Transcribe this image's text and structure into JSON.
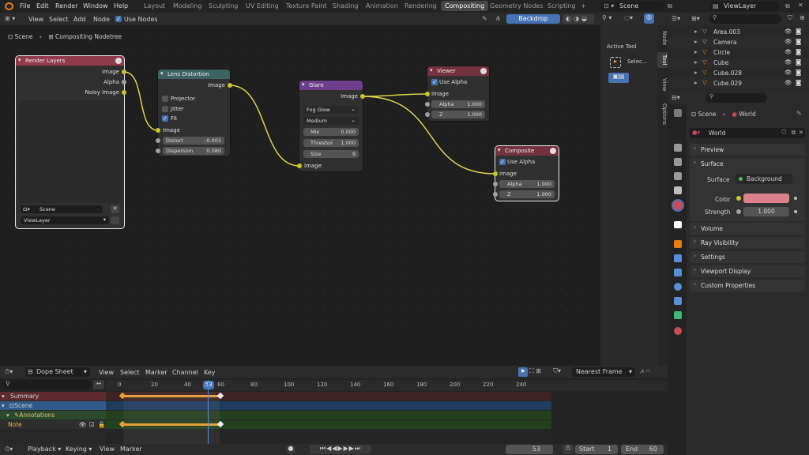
{
  "menu": {
    "file": "File",
    "edit": "Edit",
    "render": "Render",
    "window": "Window",
    "help": "Help"
  },
  "workspaces": [
    "Layout",
    "Modeling",
    "Sculpting",
    "UV Editing",
    "Texture Paint",
    "Shading",
    "Animation",
    "Rendering",
    "Compositing",
    "Geometry Nodes",
    "Scripting",
    "+"
  ],
  "active_workspace": "Compositing",
  "scene_field": "Scene",
  "viewlayer_field": "ViewLayer",
  "node_editor": {
    "header": {
      "view": "View",
      "select": "Select",
      "add": "Add",
      "node": "Node",
      "use_nodes": "Use Nodes",
      "backdrop": "Backdrop"
    },
    "breadcrumb": {
      "scene": "Scene",
      "tree": "Compositing Nodetree"
    },
    "nodes": {
      "render_layers": {
        "title": "Render Layers",
        "out_image": "Image",
        "out_alpha": "Alpha",
        "out_noisy": "Noisy Image",
        "scene": "Scene",
        "viewlayer": "ViewLayer"
      },
      "lens": {
        "title": "Lens Distortion",
        "out_image": "Image",
        "projector": "Projector",
        "jitter": "Jitter",
        "fit": "Fit",
        "in_image": "Image",
        "distort_label": "Distort",
        "distort_val": "-0.001",
        "dispersion_label": "Dispersion",
        "dispersion_val": "0.080"
      },
      "glare": {
        "title": "Glare",
        "out_image": "Image",
        "type": "Fog Glow",
        "quality": "Medium",
        "mix_label": "Mix",
        "mix_val": "0.000",
        "threshold_label": "Threshol",
        "threshold_val": "1.000",
        "size_label": "Size",
        "size_val": "9",
        "in_image": "Image"
      },
      "viewer": {
        "title": "Viewer",
        "use_alpha": "Use Alpha",
        "in_image": "Image",
        "alpha_label": "Alpha",
        "alpha_val": "1.000",
        "z_label": "Z",
        "z_val": "1.000"
      },
      "composite": {
        "title": "Composite",
        "use_alpha": "Use Alpha",
        "in_image": "Image",
        "alpha_label": "Alpha",
        "alpha_val": "1.000",
        "z_label": "Z",
        "z_val": "1.000"
      }
    },
    "sidebar": {
      "active_tool": "Active Tool",
      "select": "Selec...",
      "tabs": [
        "Node",
        "Tool",
        "View",
        "Options"
      ]
    }
  },
  "outliner": {
    "items": [
      "Area.003",
      "Camera",
      "Circle",
      "Cube",
      "Cube.028",
      "Cube.029"
    ]
  },
  "properties": {
    "breadcrumb_scene": "Scene",
    "breadcrumb_world": "World",
    "world_name": "World",
    "panels": {
      "preview": "Preview",
      "surface": "Surface",
      "volume": "Volume",
      "ray_visibility": "Ray Visibility",
      "settings": "Settings",
      "viewport_display": "Viewport Display",
      "custom_properties": "Custom Properties"
    },
    "surface_label": "Surface",
    "surface_value": "Background",
    "color_label": "Color",
    "color_value": "#d9818c",
    "strength_label": "Strength",
    "strength_value": "1.000"
  },
  "dopesheet": {
    "mode": "Dope Sheet",
    "view": "View",
    "select": "Select",
    "marker": "Marker",
    "channel": "Channel",
    "key": "Key",
    "snapping": "Nearest Frame",
    "ticks": [
      "0",
      "20",
      "40",
      "53",
      "60",
      "80",
      "100",
      "120",
      "140",
      "160",
      "180",
      "200",
      "220",
      "240"
    ],
    "current_frame": "53",
    "channels": [
      "Summary",
      "Scene",
      "Annotations",
      "Note"
    ]
  },
  "timeline": {
    "playback": "Playback",
    "keying": "Keying",
    "view": "View",
    "marker": "Marker",
    "frame": "53",
    "start_label": "Start",
    "start": "1",
    "end_label": "End",
    "end": "60"
  }
}
